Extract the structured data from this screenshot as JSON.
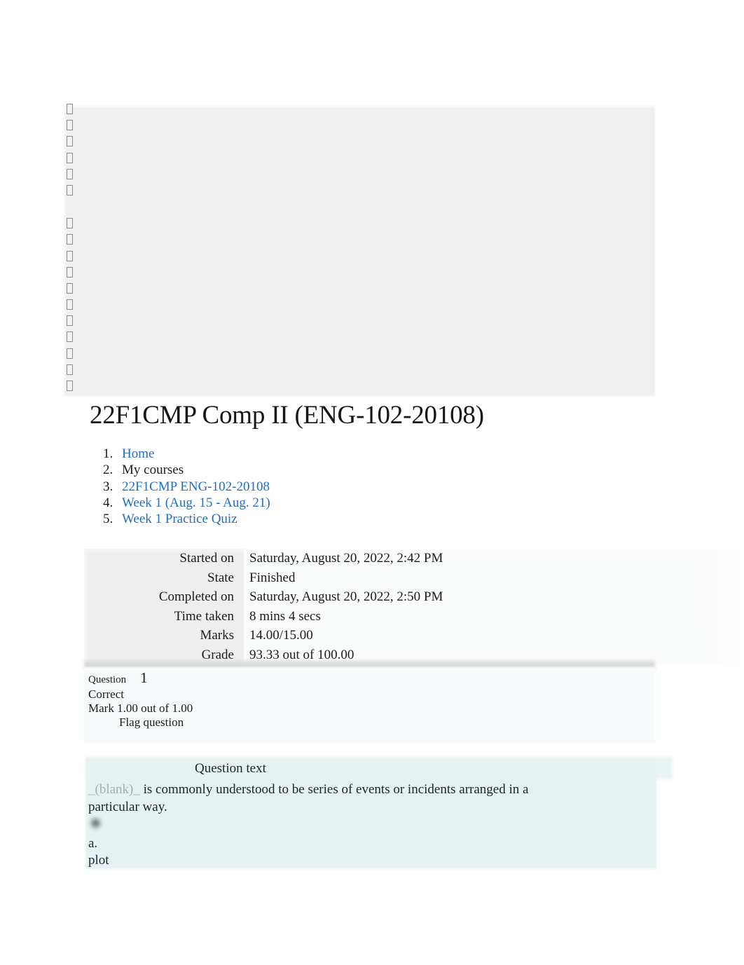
{
  "header_panel": {
    "glyph_groups": [
      6,
      11
    ],
    "glyph_icon": "missing-glyph-box"
  },
  "page_title": "22F1CMP Comp II (ENG-102-20108)",
  "breadcrumb": {
    "items": [
      {
        "label": "Home",
        "is_link": true
      },
      {
        "label": "My courses",
        "is_link": false
      },
      {
        "label": "22F1CMP ENG-102-20108",
        "is_link": true
      },
      {
        "label": "Week 1 (Aug. 15 - Aug. 21)",
        "is_link": true
      },
      {
        "label": "Week 1 Practice Quiz",
        "is_link": true
      }
    ]
  },
  "summary": {
    "rows": [
      {
        "label": "Started on",
        "value": "Saturday, August 20, 2022, 2:42 PM"
      },
      {
        "label": "State",
        "value": "Finished"
      },
      {
        "label": "Completed on",
        "value": "Saturday, August 20, 2022, 2:50 PM"
      },
      {
        "label": "Time taken",
        "value": "8 mins 4 secs"
      },
      {
        "label": "Marks",
        "value": "14.00/15.00"
      },
      {
        "label": "Grade",
        "value": "93.33 out of 100.00"
      }
    ]
  },
  "question": {
    "label": "Question",
    "number": "1",
    "state": "Correct",
    "mark": "Mark 1.00 out of 1.00",
    "flag_label": "Flag question",
    "text_heading": "Question text",
    "blank_token": "_(blank)_",
    "body_before": "",
    "body_after": " is commonly understood to be series of events or incidents arranged in a particular way.",
    "answers": [
      {
        "letter": "a.",
        "text": "plot",
        "selected": true
      }
    ]
  },
  "colors": {
    "link": "#1f6fc4",
    "header_panel_bg": "#f0f0f0",
    "summary_label_bg": "#eeeeee",
    "summary_value_bg": "#fafbfb",
    "question_block_bg": "#f6fafb",
    "question_text_bg": "#e7f1f2",
    "blank_token": "#9fb1b4",
    "body_text": "#1a1a1a"
  }
}
